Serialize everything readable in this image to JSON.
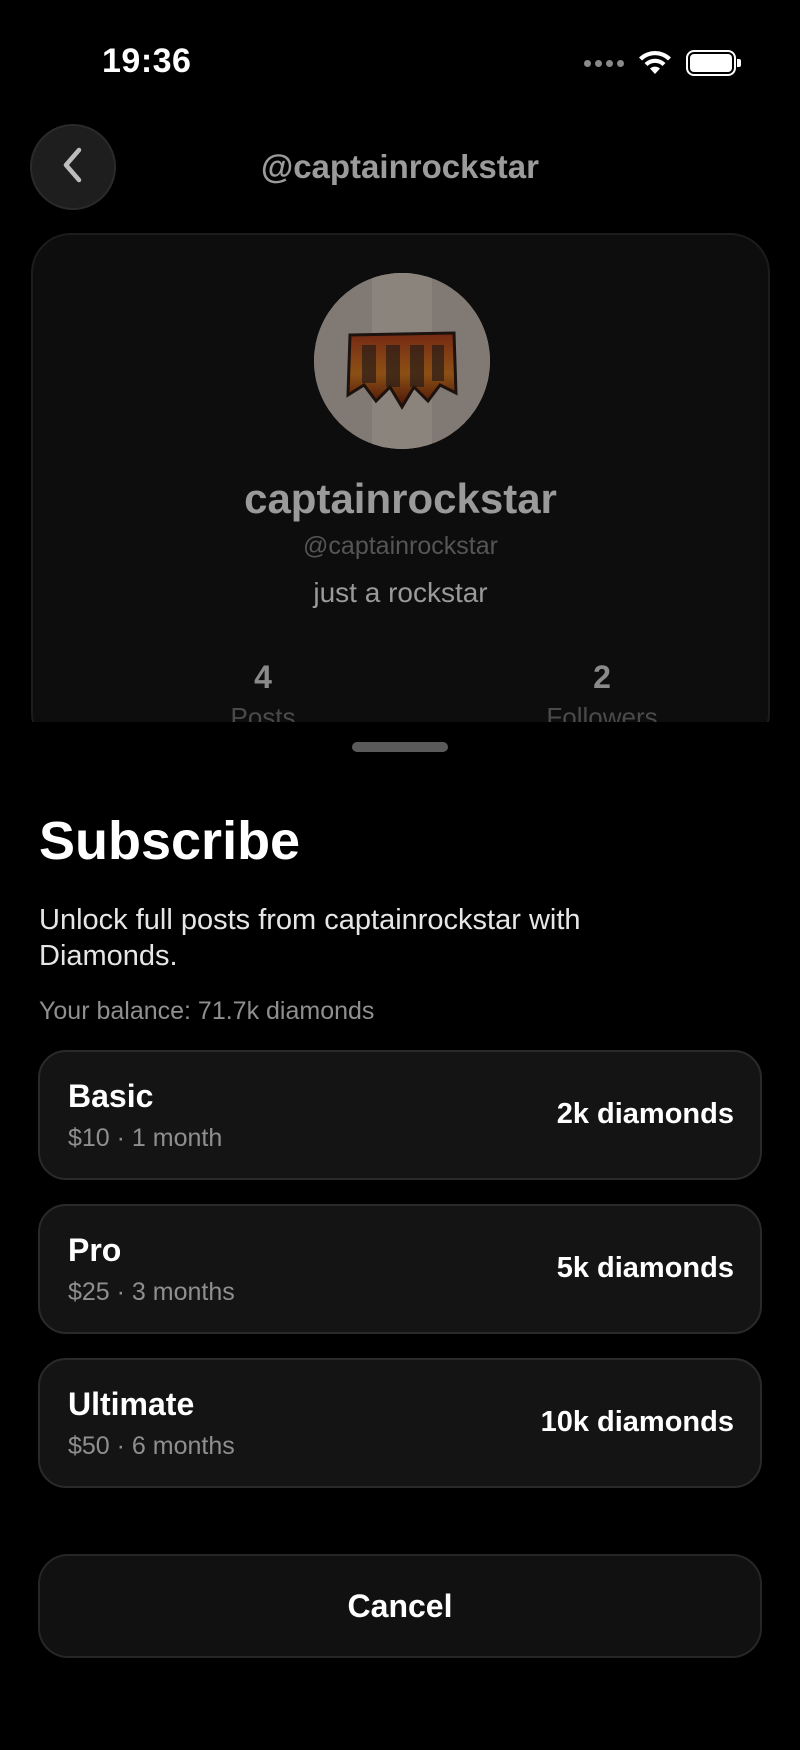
{
  "status_bar": {
    "time": "19:36",
    "icons": [
      "cellular-signal-icon",
      "wifi-icon",
      "battery-icon"
    ]
  },
  "header": {
    "title": "@captainrockstar",
    "back_icon": "chevron-left-icon"
  },
  "profile": {
    "avatar_icon": "avatar-image",
    "name": "captainrockstar",
    "handle": "@captainrockstar",
    "bio": "just a rockstar",
    "stats": [
      {
        "value": "4",
        "label": "Posts"
      },
      {
        "value": "2",
        "label": "Followers"
      }
    ]
  },
  "subscribe_sheet": {
    "title": "Subscribe",
    "description": "Unlock full posts from captainrockstar with Diamonds.",
    "balance": "Your balance: 71.7k diamonds",
    "plans": [
      {
        "name": "Basic",
        "detail": "$10 · 1 month",
        "price": "2k diamonds"
      },
      {
        "name": "Pro",
        "detail": "$25 · 3 months",
        "price": "5k diamonds"
      },
      {
        "name": "Ultimate",
        "detail": "$50 · 6 months",
        "price": "10k diamonds"
      }
    ],
    "cancel_label": "Cancel"
  },
  "colors": {
    "background": "#000000",
    "card": "#141414",
    "text_primary": "#ffffff",
    "text_secondary": "#8f8f8f"
  }
}
